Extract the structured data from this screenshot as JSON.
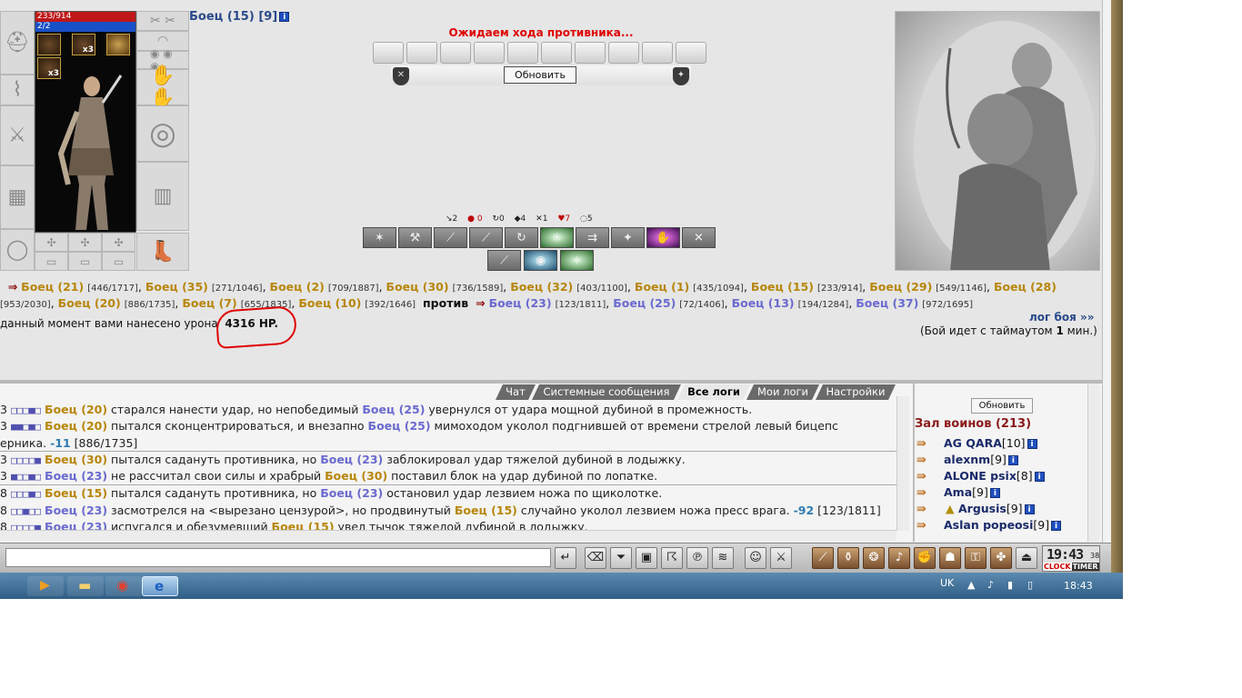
{
  "character": {
    "hp": "233/914",
    "mp": "2/2",
    "effects": [
      {
        "count": ""
      },
      {
        "count": "x3"
      },
      {
        "count": ""
      },
      {
        "count": "x3"
      }
    ],
    "name": "Боец (15) [9]",
    "info_icon": "i"
  },
  "battle": {
    "waiting_text": "Ожидаем хода противника...",
    "refresh_label": "Обновить",
    "stats": [
      "↘2",
      "● 0",
      "↻0",
      "◆4",
      "✕1",
      "♥7",
      "◌5"
    ],
    "team1": [
      {
        "name": "Боец (21)",
        "hp": "[446/1717]"
      },
      {
        "name": "Боец (35)",
        "hp": "[271/1046]"
      },
      {
        "name": "Боец (2)",
        "hp": "[709/1887]"
      },
      {
        "name": "Боец (30)",
        "hp": "[736/1589]"
      },
      {
        "name": "Боец (32)",
        "hp": "[403/1100]"
      },
      {
        "name": "Боец (1)",
        "hp": "[435/1094]"
      },
      {
        "name": "Боец (15)",
        "hp": "[233/914]"
      },
      {
        "name": "Боец (29)",
        "hp": "[549/1146]"
      },
      {
        "name": "Боец (28)",
        "hp": "[953/2030]"
      },
      {
        "name": "Боец (20)",
        "hp": "[886/1735]"
      },
      {
        "name": "Боец (7)",
        "hp": "[655/1835]"
      },
      {
        "name": "Боец (10)",
        "hp": "[392/1646]"
      }
    ],
    "vs": "против",
    "team2": [
      {
        "name": "Боец (23)",
        "hp": "[123/1811]"
      },
      {
        "name": "Боец (25)",
        "hp": "[72/1406]"
      },
      {
        "name": "Боец (13)",
        "hp": "[194/1284]"
      },
      {
        "name": "Боец (37)",
        "hp": "[972/1695]"
      }
    ],
    "damage_prefix": "данный момент вами нанесено урона",
    "damage_value": "4316 HP.",
    "log_link": "лог боя »»",
    "timeout_prefix": "(Бой идет с таймаутом",
    "timeout_value": "1",
    "timeout_suffix": "мин.)"
  },
  "chat": {
    "tabs": [
      "Чат",
      "Системные сообщения",
      "Все логи",
      "Мои логи",
      "Настройки"
    ],
    "selected_tab": "Все логи",
    "lines": [
      {
        "prefix": "3",
        "a": "Боец (20)",
        "t1": " старался нанести удар, но непобедимый ",
        "b": "Боец (25)",
        "t2": " увернулся от удара мощной дубиной в промежность.",
        "sep": false
      },
      {
        "prefix": "3",
        "a": "Боец (20)",
        "t1": " пытался сконцентрироваться, и внезапно ",
        "b": "Боец (25)",
        "t2": " мимоходом уколол подгнившей от времени стрелой левый бицепс",
        "sep": false
      },
      {
        "prefix": "",
        "a": "",
        "t1": "ерника. ",
        "b": "",
        "t2": "",
        "neg": "-11",
        "tail": " [886/1735]",
        "sep": false
      },
      {
        "prefix": "3",
        "a": "Боец (30)",
        "t1": " пытался садануть противника, но ",
        "b": "Боец (23)",
        "t2": " заблокировал удар тяжелой дубиной в лодыжку.",
        "sep": true
      },
      {
        "prefix": "3",
        "a": "Боец (23)",
        "t1": " не рассчитал свои силы и храбрый ",
        "b": "Боец (30)",
        "t2": " поставил блок на удар дубиной по лопатке.",
        "sep": false
      },
      {
        "prefix": "8",
        "a": "Боец (15)",
        "t1": " пытался садануть противника, но ",
        "b": "Боец (23)",
        "t2": " остановил удар лезвием ножа по щиколотке.",
        "sep": true
      },
      {
        "prefix": "8",
        "a": "Боец (23)",
        "t1": " засмотрелся на <вырезано цензурой>, но продвинутый ",
        "b": "Боец (15)",
        "t2": " случайно уколол лезвием ножа пресс врага. ",
        "neg": "-92",
        "tail": " [123/1811]",
        "sep": false
      },
      {
        "prefix": "8",
        "a": "Боец (23)",
        "t1": " испугался и обезумевший ",
        "b": "Боец (15)",
        "t2": " увел тычок тяжелой дубиной в лодыжку.",
        "sep": false
      }
    ]
  },
  "hall": {
    "refresh_label": "Обновить",
    "title": "Зал воинов (213)",
    "users": [
      {
        "name": "AG QARA",
        "level": "[10]"
      },
      {
        "name": "alexnm",
        "level": "[9]"
      },
      {
        "name": "ALONE psix",
        "level": "[8]"
      },
      {
        "name": "Ama",
        "level": "[9]"
      },
      {
        "name": "Argusis",
        "level": "[9]"
      },
      {
        "name": "Aslan popeosi",
        "level": "[9]"
      }
    ]
  },
  "toolbar": {
    "clock_time": "19:43",
    "clock_seconds": "38",
    "clock_label": "CLOCK",
    "timer_label": "TIMER"
  },
  "taskbar": {
    "lang": "UK",
    "time": "18:43"
  }
}
